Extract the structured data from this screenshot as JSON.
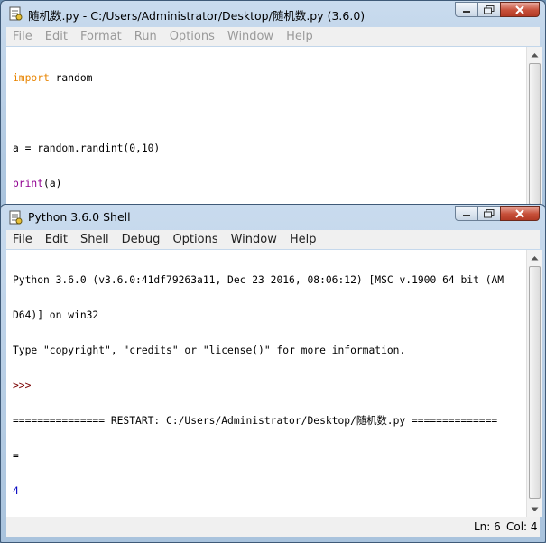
{
  "editor": {
    "title": "随机数.py - C:/Users/Administrator/Desktop/随机数.py (3.6.0)",
    "menu": [
      "File",
      "Edit",
      "Format",
      "Run",
      "Options",
      "Window",
      "Help"
    ],
    "code": {
      "line1_kw": "import",
      "line1_rest": " random",
      "line3": "a = random.randint(0,10)",
      "line4_fn": "print",
      "line4_rest": "(a)"
    }
  },
  "shell": {
    "title": "Python 3.6.0 Shell",
    "menu": [
      "File",
      "Edit",
      "Shell",
      "Debug",
      "Options",
      "Window",
      "Help"
    ],
    "banner_line1": "Python 3.6.0 (v3.6.0:41df79263a11, Dec 23 2016, 08:06:12) [MSC v.1900 64 bit (AM",
    "banner_line2": "D64)] on win32",
    "banner_line3": "Type \"copyright\", \"credits\" or \"license()\" for more information.",
    "prompt": ">>>",
    "restart_line": "=============== RESTART: C:/Users/Administrator/Desktop/随机数.py ==============",
    "restart_wrap": "=",
    "output": "4",
    "status": {
      "line": "Ln: 6",
      "col": "Col: 4"
    }
  },
  "colors": {
    "keyword": "#e88400",
    "builtin": "#900090",
    "prompt": "#7a0000",
    "output": "#0000c0"
  }
}
